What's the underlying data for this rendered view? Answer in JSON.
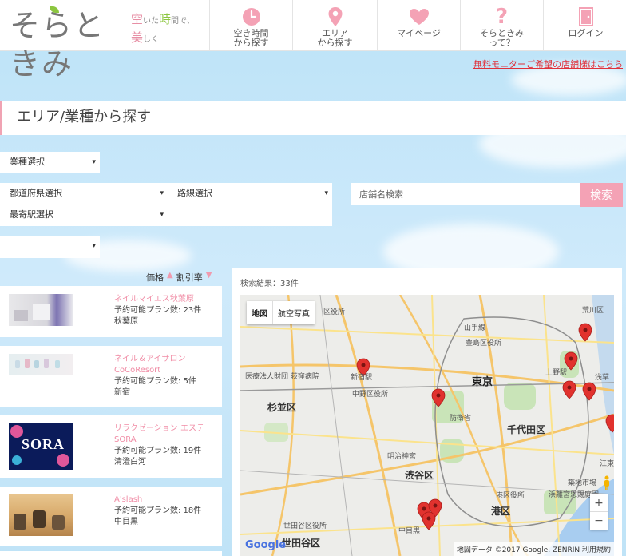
{
  "header": {
    "logo_text": "そらときみ",
    "tagline_line1_a": "空",
    "tagline_line1_b": "いた",
    "tagline_line1_c": "時",
    "tagline_line1_d": "間で、",
    "tagline_line2_a": "美",
    "tagline_line2_b": "しく",
    "nav": [
      {
        "label": "空き時間\nから探す",
        "icon": "clock-icon",
        "color": "#f4a2b5"
      },
      {
        "label": "エリア\nから探す",
        "icon": "map-pin-icon",
        "color": "#f4a2b5"
      },
      {
        "label": "マイページ",
        "icon": "heart-icon",
        "color": "#f4a2b5"
      },
      {
        "label": "そらときみ\nって？",
        "icon": "question-icon",
        "color": "#f4a2b5"
      },
      {
        "label": "ログイン",
        "icon": "door-icon",
        "color": "#f4a2b5"
      }
    ]
  },
  "monitor_link": "無料モニターご希望の店舗様はこちら",
  "page_title": "エリア/業種から探す",
  "filters": {
    "genre": "業種選択",
    "prefecture": "都道府県選択",
    "line": "路線選択",
    "station": "最寄駅選択",
    "extra": "",
    "search_placeholder": "店舗名検索",
    "search_button": "検索"
  },
  "sort": {
    "price": "価格",
    "discount": "割引率"
  },
  "results": {
    "count_text": "検索結果：33件",
    "items": [
      {
        "name": "ネイルマイエス秋葉原",
        "plans": "予約可能プラン数: 23件",
        "area": "秋葉原"
      },
      {
        "name": "ネイル＆アイサロン CoCoResort",
        "plans": "予約可能プラン数: 5件",
        "area": "新宿"
      },
      {
        "name": "リラクゼーション エステ SORA",
        "plans": "予約可能プラン数: 19件",
        "area": "清澄白河",
        "thumb_text": "SORA"
      },
      {
        "name": "A'slash",
        "plans": "予約可能プラン数: 18件",
        "area": "中目黒"
      }
    ]
  },
  "map": {
    "type_map": "地図",
    "type_satellite": "航空写真",
    "zoom_in": "+",
    "zoom_out": "−",
    "google": "Google",
    "credit": "地図データ ©2017 Google, ZENRIN 利用規約",
    "labels": {
      "tokyo": "東京",
      "suginami": "杉並区",
      "shibuya": "渋谷区",
      "setagaya": "世田谷区",
      "chiyoda": "千代田区",
      "minato": "港区",
      "nakano": "中野区役所",
      "toshima": "豊島区役所",
      "meiji": "明治神宮",
      "bouei": "防衛省",
      "tsukiji": "築地市場",
      "hamarikyu": "浜離宮恩賜庭園",
      "setagaya_office": "世田谷区役所",
      "minato_office": "港区役所",
      "arakawa": "荒川区",
      "hospital": "医療法人財団 荻窪病院",
      "kita_office": "区役所",
      "yamanote": "山手線",
      "ueno": "上野駅",
      "asakusa": "浅草",
      "koto": "江東",
      "shinjuku_station": "新宿駅",
      "nakameguro": "中目黒"
    }
  }
}
